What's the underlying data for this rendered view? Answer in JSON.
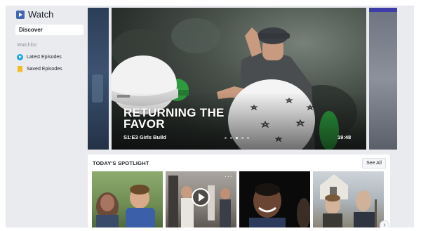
{
  "app": {
    "title": "Watch",
    "icon": "watch-play-icon",
    "accent": "#4267b2"
  },
  "sidebar": {
    "discover_label": "Discover",
    "section_label": "Watchlist",
    "items": [
      {
        "label": "Latest Episodes",
        "icon": "play-circle-icon",
        "color": "#1aa7e6"
      },
      {
        "label": "Saved Episodes",
        "icon": "bookmark-icon",
        "color": "#f7b928"
      }
    ]
  },
  "hero": {
    "title": "RETURNING THE FAVOR",
    "episode": "S1:E3 Girls Build",
    "duration": "19:48",
    "dots": 5,
    "active_dot": 3
  },
  "spotlight": {
    "heading": "TODAY'S SPOTLIGHT",
    "see_all_label": "See All",
    "next_icon": "chevron-right-icon",
    "cards": [
      {
        "icon": null
      },
      {
        "icon": "play-icon",
        "menu_icon": "more-icon"
      },
      {
        "icon": null
      },
      {
        "icon": null
      }
    ]
  }
}
